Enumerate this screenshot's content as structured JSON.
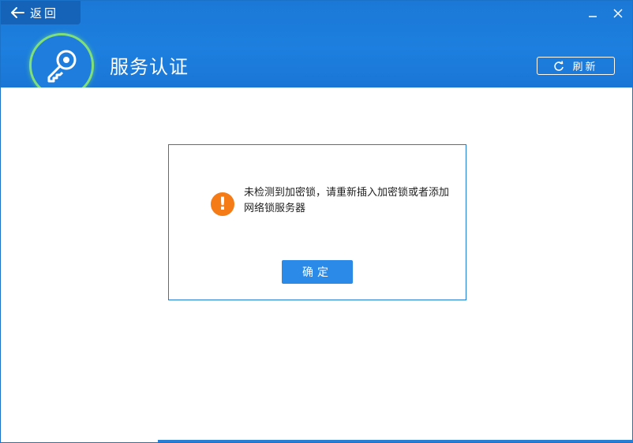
{
  "header": {
    "back_label": "返回",
    "title": "服务认证",
    "refresh_label": "刷新"
  },
  "dialog": {
    "message": "未检测到加密锁，请重新插入加密锁或者添加网络锁服务器",
    "ok_label": "确定"
  },
  "icons": {
    "back": "arrow-left-icon",
    "minimize": "minimize-icon",
    "close": "close-icon",
    "logo": "key-icon",
    "refresh": "refresh-icon",
    "warning": "warning-icon"
  },
  "colors": {
    "header_blue": "#1d7fdf",
    "accent_green": "#7fe07a",
    "warning_orange": "#f47b16",
    "button_blue": "#2b8ae8"
  }
}
